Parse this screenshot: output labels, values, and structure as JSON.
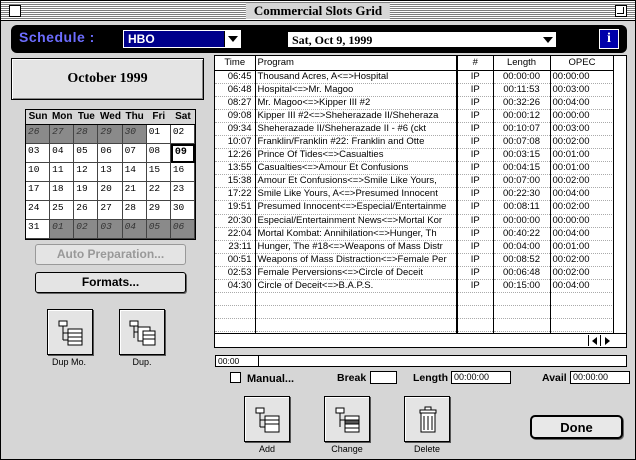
{
  "window": {
    "title": "Commercial Slots Grid"
  },
  "header": {
    "schedule_label": "Schedule :",
    "channel": "HBO",
    "date": "Sat, Oct 9, 1999",
    "info_glyph": "i"
  },
  "calendar": {
    "month_title": "October 1999",
    "weekdays": [
      "Sun",
      "Mon",
      "Tue",
      "Wed",
      "Thu",
      "Fri",
      "Sat"
    ],
    "days": [
      {
        "d": "26",
        "other": true
      },
      {
        "d": "27",
        "other": true
      },
      {
        "d": "28",
        "other": true
      },
      {
        "d": "29",
        "other": true
      },
      {
        "d": "30",
        "other": true
      },
      {
        "d": "01"
      },
      {
        "d": "02"
      },
      {
        "d": "03"
      },
      {
        "d": "04"
      },
      {
        "d": "05"
      },
      {
        "d": "06"
      },
      {
        "d": "07"
      },
      {
        "d": "08"
      },
      {
        "d": "09",
        "today": true
      },
      {
        "d": "10"
      },
      {
        "d": "11"
      },
      {
        "d": "12"
      },
      {
        "d": "13"
      },
      {
        "d": "14"
      },
      {
        "d": "15"
      },
      {
        "d": "16"
      },
      {
        "d": "17"
      },
      {
        "d": "18"
      },
      {
        "d": "19"
      },
      {
        "d": "20"
      },
      {
        "d": "21"
      },
      {
        "d": "22"
      },
      {
        "d": "23"
      },
      {
        "d": "24"
      },
      {
        "d": "25"
      },
      {
        "d": "26"
      },
      {
        "d": "27"
      },
      {
        "d": "28"
      },
      {
        "d": "29"
      },
      {
        "d": "30"
      },
      {
        "d": "31"
      },
      {
        "d": "01",
        "other": true
      },
      {
        "d": "02",
        "other": true
      },
      {
        "d": "03",
        "other": true
      },
      {
        "d": "04",
        "other": true
      },
      {
        "d": "05",
        "other": true
      },
      {
        "d": "06",
        "other": true
      }
    ]
  },
  "buttons": {
    "auto_preparation": "Auto Preparation...",
    "formats": "Formats...",
    "dup_mo": "Dup Mo.",
    "dup": "Dup.",
    "add": "Add",
    "change": "Change",
    "delete": "Delete",
    "done": "Done"
  },
  "table": {
    "columns": [
      "Time",
      "Program",
      "#",
      "Length",
      "OPEC"
    ],
    "rows": [
      {
        "time": "06:45",
        "program": "Thousand Acres, A<=>Hospital",
        "code": "IP",
        "length": "00:00:00",
        "opec": "00:00:00"
      },
      {
        "time": "06:48",
        "program": "Hospital<=>Mr. Magoo",
        "code": "IP",
        "length": "00:11:53",
        "opec": "00:03:00"
      },
      {
        "time": "08:27",
        "program": "Mr. Magoo<=>Kipper III #2",
        "code": "IP",
        "length": "00:32:26",
        "opec": "00:04:00"
      },
      {
        "time": "09:08",
        "program": "Kipper III #2<=>Sheherazade II/Sheheraza",
        "code": "IP",
        "length": "00:00:12",
        "opec": "00:00:00"
      },
      {
        "time": "09:34",
        "program": "Sheherazade II/Sheherazade II - #6 (ckt",
        "code": "IP",
        "length": "00:10:07",
        "opec": "00:03:00"
      },
      {
        "time": "10:07",
        "program": "Franklin/Franklin #22: Franklin and Otte",
        "code": "IP",
        "length": "00:07:08",
        "opec": "00:02:00"
      },
      {
        "time": "12:26",
        "program": "Prince Of Tides<=>Casualties",
        "code": "IP",
        "length": "00:03:15",
        "opec": "00:01:00"
      },
      {
        "time": "13:55",
        "program": "Casualties<=>Amour Et Confusions",
        "code": "IP",
        "length": "00:04:15",
        "opec": "00:01:00"
      },
      {
        "time": "15:38",
        "program": "Amour Et Confusions<=>Smile Like Yours,",
        "code": "IP",
        "length": "00:07:00",
        "opec": "00:02:00"
      },
      {
        "time": "17:22",
        "program": "Smile Like Yours, A<=>Presumed Innocent",
        "code": "IP",
        "length": "00:22:30",
        "opec": "00:04:00"
      },
      {
        "time": "19:51",
        "program": "Presumed Innocent<=>Especial/Entertainme",
        "code": "IP",
        "length": "00:08:11",
        "opec": "00:02:00"
      },
      {
        "time": "20:30",
        "program": "Especial/Entertainment News<=>Mortal Kor",
        "code": "IP",
        "length": "00:00:00",
        "opec": "00:00:00"
      },
      {
        "time": "22:04",
        "program": "Mortal Kombat: Annihilation<=>Hunger, Th",
        "code": "IP",
        "length": "00:40:22",
        "opec": "00:04:00"
      },
      {
        "time": "23:11",
        "program": "Hunger, The #18<=>Weapons of Mass Distr",
        "code": "IP",
        "length": "00:04:00",
        "opec": "00:01:00"
      },
      {
        "time": "00:51",
        "program": "Weapons of Mass Distraction<=>Female Per",
        "code": "IP",
        "length": "00:08:52",
        "opec": "00:02:00"
      },
      {
        "time": "02:53",
        "program": "Female Perversions<=>Circle of Deceit",
        "code": "IP",
        "length": "00:06:48",
        "opec": "00:02:00"
      },
      {
        "time": "04:30",
        "program": "Circle of Deceit<=>B.A.P.S.",
        "code": "IP",
        "length": "00:15:00",
        "opec": "00:04:00"
      }
    ],
    "blank_rows": 4
  },
  "edit": {
    "time_value": "00:00",
    "manual_label": "Manual...",
    "break_label": "Break",
    "break_value": "",
    "length_label": "Length",
    "length_value": "00:00:00",
    "avail_label": "Avail",
    "avail_value": "00:00:00"
  }
}
